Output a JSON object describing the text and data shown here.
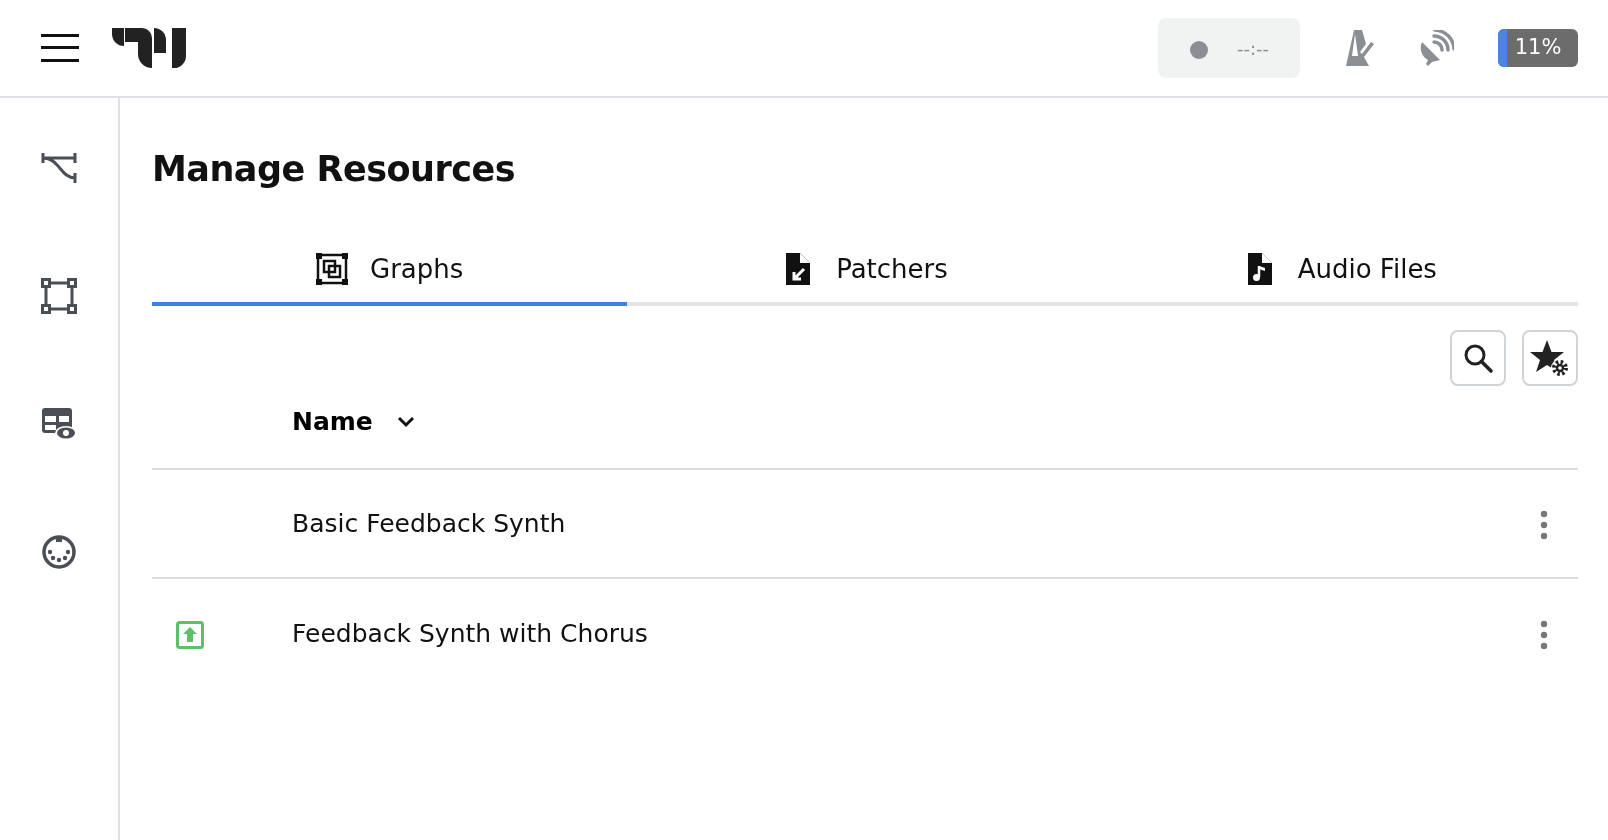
{
  "header": {
    "transport": {
      "recording": false,
      "time": "--:--"
    },
    "cpu": {
      "level": 0.11,
      "reading": "11%"
    }
  },
  "page": {
    "title": "Manage Resources"
  },
  "tabs": [
    {
      "label": "Graphs",
      "kind": "graph",
      "selected": true
    },
    {
      "label": "Patchers",
      "kind": "patcher",
      "selected": false
    },
    {
      "label": "Audio Files",
      "kind": "audio",
      "selected": false
    }
  ],
  "table": {
    "columns": [
      "Name"
    ],
    "rows": [
      {
        "name": "Basic Feedback Synth",
        "loaded": false
      },
      {
        "name": "Feedback Synth with Chorus",
        "loaded": true
      }
    ]
  }
}
